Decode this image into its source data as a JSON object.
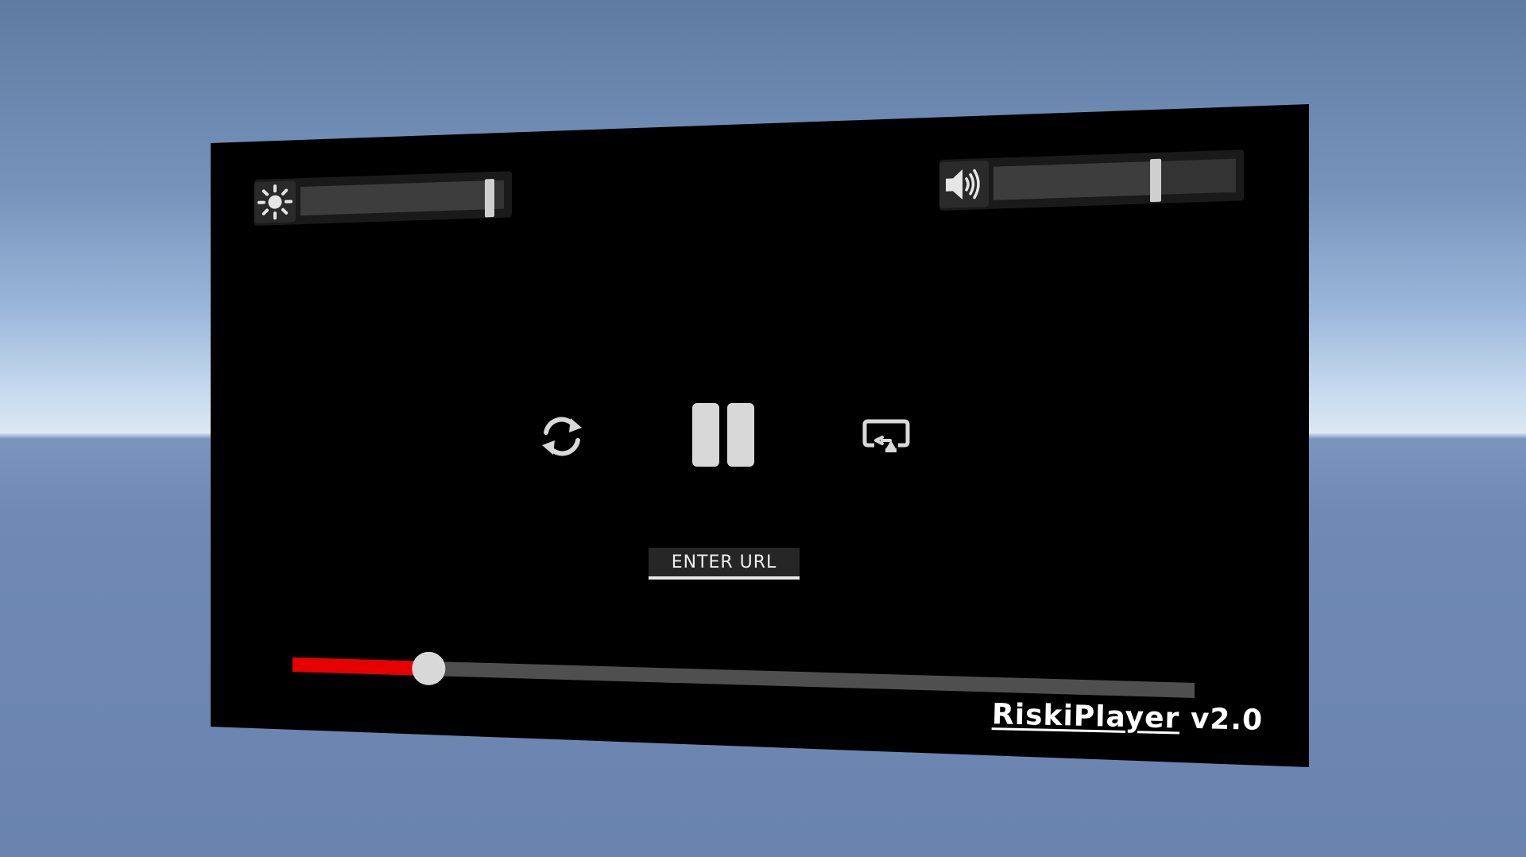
{
  "player": {
    "brand_name": "RiskiPlayer",
    "brand_version": " v2.0",
    "url_button_label": "ENTER URL",
    "brightness_level": 0.93,
    "volume_level": 0.67,
    "playback_progress": 0.151,
    "state": "playing"
  },
  "icons": {
    "brightness": "sun-icon",
    "volume": "speaker-volume-icon",
    "reload": "refresh-icon",
    "pause": "pause-icon",
    "cast": "screen-cast-icon"
  },
  "colors": {
    "progress_fill": "#e60000",
    "progress_track": "#4f4f4f",
    "screen_background": "#000000",
    "handle": "#d8d8d8"
  }
}
